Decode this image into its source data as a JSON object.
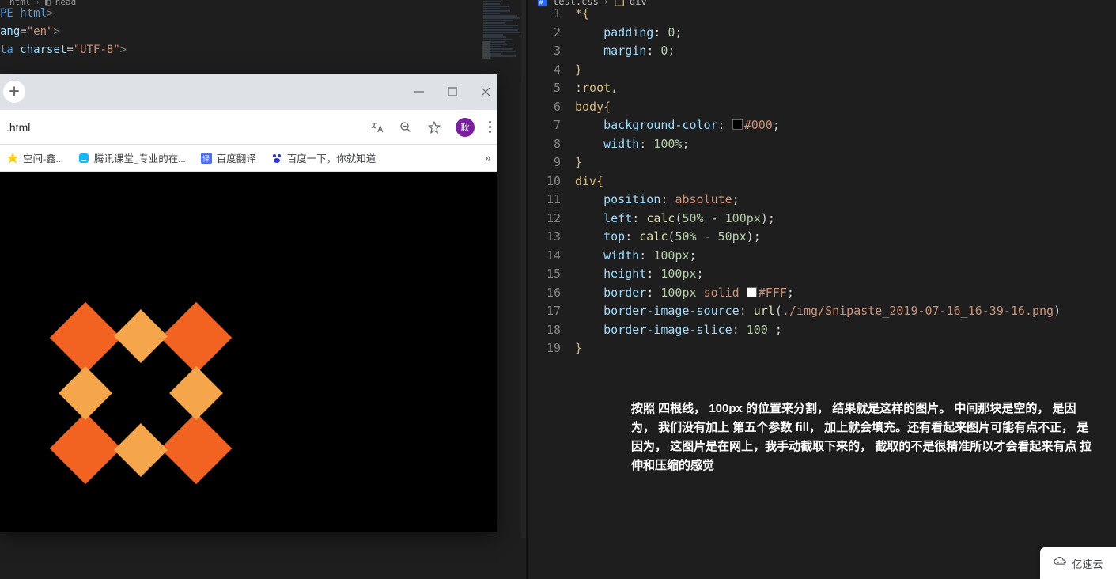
{
  "left_editor": {
    "breadcrumb": {
      "file": "html",
      "item": "head",
      "icon": "cube-icon"
    },
    "lines": [
      {
        "parts": [
          {
            "t": "el",
            "v": "PE html"
          },
          {
            "t": "tag",
            "v": ">"
          }
        ]
      },
      {
        "parts": [
          {
            "t": "attr",
            "v": "ang"
          },
          {
            "t": "op",
            "v": "="
          },
          {
            "t": "str",
            "v": "\"en\""
          },
          {
            "t": "tag",
            "v": ">"
          }
        ]
      },
      {
        "parts": []
      },
      {
        "parts": [
          {
            "t": "el",
            "v": "ta "
          },
          {
            "t": "attr",
            "v": "charset"
          },
          {
            "t": "op",
            "v": "="
          },
          {
            "t": "str",
            "v": "\"UTF-8\""
          },
          {
            "t": "tag",
            "v": ">"
          }
        ]
      }
    ]
  },
  "right_editor": {
    "breadcrumb": {
      "file": "test.css",
      "selector": "div",
      "file_icon": "css-file-icon",
      "selector_icon": "selector-icon"
    },
    "lines": [
      [
        {
          "t": "sel",
          "v": "*"
        },
        {
          "t": "brk",
          "v": "{"
        }
      ],
      [
        {
          "t": "pad",
          "v": "    "
        },
        {
          "t": "prop",
          "v": "padding"
        },
        {
          "t": "punc",
          "v": ": "
        },
        {
          "t": "num",
          "v": "0"
        },
        {
          "t": "punc",
          "v": ";"
        }
      ],
      [
        {
          "t": "pad",
          "v": "    "
        },
        {
          "t": "prop",
          "v": "margin"
        },
        {
          "t": "punc",
          "v": ": "
        },
        {
          "t": "num",
          "v": "0"
        },
        {
          "t": "punc",
          "v": ";"
        }
      ],
      [
        {
          "t": "brk",
          "v": "}"
        }
      ],
      [
        {
          "t": "sel",
          "v": ":root"
        },
        {
          "t": "punc",
          "v": ","
        }
      ],
      [
        {
          "t": "sel",
          "v": "body"
        },
        {
          "t": "brk",
          "v": "{"
        }
      ],
      [
        {
          "t": "pad",
          "v": "    "
        },
        {
          "t": "prop",
          "v": "background-color"
        },
        {
          "t": "punc",
          "v": ": "
        },
        {
          "t": "swatch",
          "v": "black"
        },
        {
          "t": "val",
          "v": "#000"
        },
        {
          "t": "punc",
          "v": ";"
        }
      ],
      [
        {
          "t": "pad",
          "v": "    "
        },
        {
          "t": "prop",
          "v": "width"
        },
        {
          "t": "punc",
          "v": ": "
        },
        {
          "t": "num",
          "v": "100%"
        },
        {
          "t": "punc",
          "v": ";"
        }
      ],
      [
        {
          "t": "brk",
          "v": "}"
        }
      ],
      [
        {
          "t": "sel",
          "v": "div"
        },
        {
          "t": "brk",
          "v": "{"
        }
      ],
      [
        {
          "t": "pad",
          "v": "    "
        },
        {
          "t": "prop",
          "v": "position"
        },
        {
          "t": "punc",
          "v": ": "
        },
        {
          "t": "val",
          "v": "absolute"
        },
        {
          "t": "punc",
          "v": ";"
        }
      ],
      [
        {
          "t": "pad",
          "v": "    "
        },
        {
          "t": "prop",
          "v": "left"
        },
        {
          "t": "punc",
          "v": ": "
        },
        {
          "t": "fn",
          "v": "calc"
        },
        {
          "t": "punc",
          "v": "("
        },
        {
          "t": "num",
          "v": "50%"
        },
        {
          "t": "punc",
          "v": " - "
        },
        {
          "t": "num",
          "v": "100px"
        },
        {
          "t": "punc",
          "v": ");"
        }
      ],
      [
        {
          "t": "pad",
          "v": "    "
        },
        {
          "t": "prop",
          "v": "top"
        },
        {
          "t": "punc",
          "v": ": "
        },
        {
          "t": "fn",
          "v": "calc"
        },
        {
          "t": "punc",
          "v": "("
        },
        {
          "t": "num",
          "v": "50%"
        },
        {
          "t": "punc",
          "v": " - "
        },
        {
          "t": "num",
          "v": "50px"
        },
        {
          "t": "punc",
          "v": ");"
        }
      ],
      [
        {
          "t": "pad",
          "v": "    "
        },
        {
          "t": "prop",
          "v": "width"
        },
        {
          "t": "punc",
          "v": ": "
        },
        {
          "t": "num",
          "v": "100px"
        },
        {
          "t": "punc",
          "v": ";"
        }
      ],
      [
        {
          "t": "pad",
          "v": "    "
        },
        {
          "t": "prop",
          "v": "height"
        },
        {
          "t": "punc",
          "v": ": "
        },
        {
          "t": "num",
          "v": "100px"
        },
        {
          "t": "punc",
          "v": ";"
        }
      ],
      [
        {
          "t": "pad",
          "v": "    "
        },
        {
          "t": "prop",
          "v": "border"
        },
        {
          "t": "punc",
          "v": ": "
        },
        {
          "t": "num",
          "v": "100px"
        },
        {
          "t": "punc",
          "v": " "
        },
        {
          "t": "val",
          "v": "solid"
        },
        {
          "t": "punc",
          "v": " "
        },
        {
          "t": "swatch",
          "v": "white"
        },
        {
          "t": "val",
          "v": "#FFF"
        },
        {
          "t": "punc",
          "v": ";"
        }
      ],
      [
        {
          "t": "pad",
          "v": "    "
        },
        {
          "t": "prop",
          "v": "border-image-source"
        },
        {
          "t": "punc",
          "v": ": "
        },
        {
          "t": "fn",
          "v": "url"
        },
        {
          "t": "punc",
          "v": "("
        },
        {
          "t": "url",
          "v": "./img/Snipaste_2019-07-16_16-39-16.png"
        },
        {
          "t": "punc",
          "v": ")"
        }
      ],
      [
        {
          "t": "pad",
          "v": "    "
        },
        {
          "t": "prop",
          "v": "border-image-slice"
        },
        {
          "t": "punc",
          "v": ": "
        },
        {
          "t": "num",
          "v": "100"
        },
        {
          "t": "punc",
          "v": " ;"
        }
      ],
      [
        {
          "t": "brk",
          "v": "}"
        }
      ]
    ],
    "line_start": 1,
    "line_end": 19
  },
  "explain_text": "按照 四根线， 100px 的位置来分割， 结果就是这样的图片。 中间那块是空的， 是因为， 我们没有加上 第五个参数  fill， 加上就会填充。还有看起来图片可能有点不正， 是因为， 这图片是在网上，我手动截取下来的， 截取的不是很精准所以才会看起来有点 拉伸和压缩的感觉",
  "browser": {
    "newtab_tooltip": "+",
    "omnibox": ".html",
    "avatar_initial": "耿",
    "bookmarks": [
      {
        "icon": "qzone-icon",
        "label": "空间-鑫..."
      },
      {
        "icon": "tencent-icon",
        "label": "腾讯课堂_专业的在..."
      },
      {
        "icon": "baidu-translate-icon",
        "label": "百度翻译"
      },
      {
        "icon": "baidu-icon",
        "label": "百度一下，你就知道"
      }
    ],
    "bookmarks_overflow": "»",
    "toolbar_icons": {
      "translate": "translate-icon",
      "zoom": "zoom-out-icon",
      "star": "star-icon",
      "menu": "kebab-menu-icon"
    },
    "window_controls": {
      "min": "minimize-icon",
      "max": "maximize-icon",
      "close": "close-icon"
    }
  },
  "watermark": {
    "text": "亿速云",
    "icon": "cloud-icon"
  }
}
